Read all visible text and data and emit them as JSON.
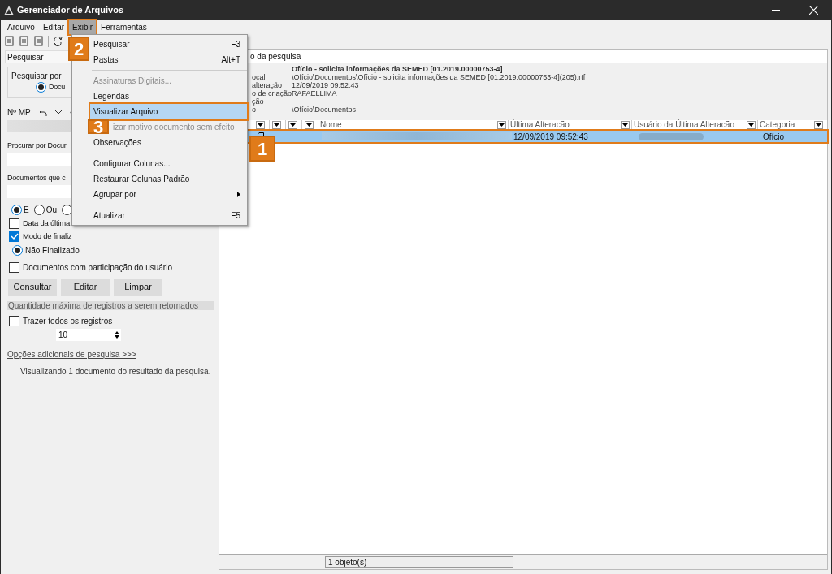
{
  "window": {
    "title": "Gerenciador de Arquivos"
  },
  "menubar": [
    {
      "label": "Arquivo",
      "selected": false
    },
    {
      "label": "Editar",
      "selected": false
    },
    {
      "label": "Exibir",
      "selected": true
    },
    {
      "label": "Ferramentas",
      "selected": false
    }
  ],
  "left_panel": {
    "title": "Pesquisar",
    "search_by": {
      "label": "Pesquisar por",
      "option": "Docu",
      "selected": true
    },
    "mp_label": "Nº MP",
    "doc_search_label": "Procurar por Docur",
    "contains_label": "Documentos que c",
    "logic": [
      {
        "label": "E",
        "selected": true
      },
      {
        "label": "Ou",
        "selected": false
      },
      {
        "selected": false
      }
    ],
    "checks": [
      {
        "label": "Data da última",
        "checked": false
      },
      {
        "label": "Modo de finaliz",
        "checked": true
      }
    ],
    "finalized": {
      "label": "Não Finalizado",
      "selected": true
    },
    "participation": {
      "label": "Documentos com participação do usuário",
      "checked": false
    },
    "buttons": [
      "Consultar",
      "Editar",
      "Limpar"
    ],
    "max_section": "Quantidade máxima de registros a serem retornados",
    "bring_all": {
      "label": "Trazer todos os registros",
      "checked": false
    },
    "max_value": "10",
    "more_link": "Opções adicionais de pesquisa >>>",
    "status": "Visualizando 1 documento do resultado da pesquisa."
  },
  "right_panel": {
    "header": "o da pesquisa",
    "doc_title": "Ofício - solicita informações da SEMED [01.2019.00000753-4]",
    "details": [
      {
        "label": "ocal",
        "value": "\\Ofício\\Documentos\\Ofício - solicita informações da SEMED [01.2019.00000753-4](205).rtf"
      },
      {
        "label": "alteração",
        "value": "12/09/2019 09:52:43"
      },
      {
        "label": "o de criação",
        "value": "RAFAELLIMA"
      },
      {
        "label": "ção"
      },
      {
        "label": "o",
        "value": "\\Ofício\\Documentos"
      }
    ],
    "table": {
      "columns": [
        "Nome",
        "Última Alteracão",
        "Usuário da Última Alteracão",
        "Categoria"
      ],
      "rows": [
        {
          "selected": true,
          "modified": "12/09/2019 09:52:43",
          "category": "Ofício"
        }
      ]
    },
    "status": "1 objeto(s)"
  },
  "menu": {
    "items": [
      {
        "kind": "item",
        "label": "Pesquisar",
        "shortcut": "F3",
        "disabled": false,
        "selected": false
      },
      {
        "kind": "item",
        "label": "Pastas",
        "shortcut": "Alt+T",
        "disabled": false,
        "selected": false
      },
      {
        "kind": "separator"
      },
      {
        "kind": "item",
        "label": "Assinaturas Digitais...",
        "disabled": true,
        "selected": false
      },
      {
        "kind": "item",
        "label": "Legendas",
        "disabled": false,
        "selected": false
      },
      {
        "kind": "item",
        "label": "Visualizar Arquivo",
        "disabled": false,
        "selected": true
      },
      {
        "kind": "covered",
        "label": "izar motivo documento sem efeito",
        "disabled": true,
        "selected": false
      },
      {
        "kind": "item",
        "label": "Observações",
        "disabled": false,
        "selected": false
      },
      {
        "kind": "separator"
      },
      {
        "kind": "item",
        "label": "Configurar Colunas...",
        "disabled": false,
        "selected": false
      },
      {
        "kind": "item",
        "label": "Restaurar Colunas Padrão",
        "disabled": false,
        "selected": false
      },
      {
        "kind": "submenu",
        "label": "Agrupar por",
        "disabled": false,
        "selected": false
      },
      {
        "kind": "separator"
      },
      {
        "kind": "item",
        "label": "Atualizar",
        "shortcut": "F5",
        "disabled": false,
        "selected": false
      }
    ]
  },
  "callouts": [
    "1",
    "2",
    "3"
  ]
}
